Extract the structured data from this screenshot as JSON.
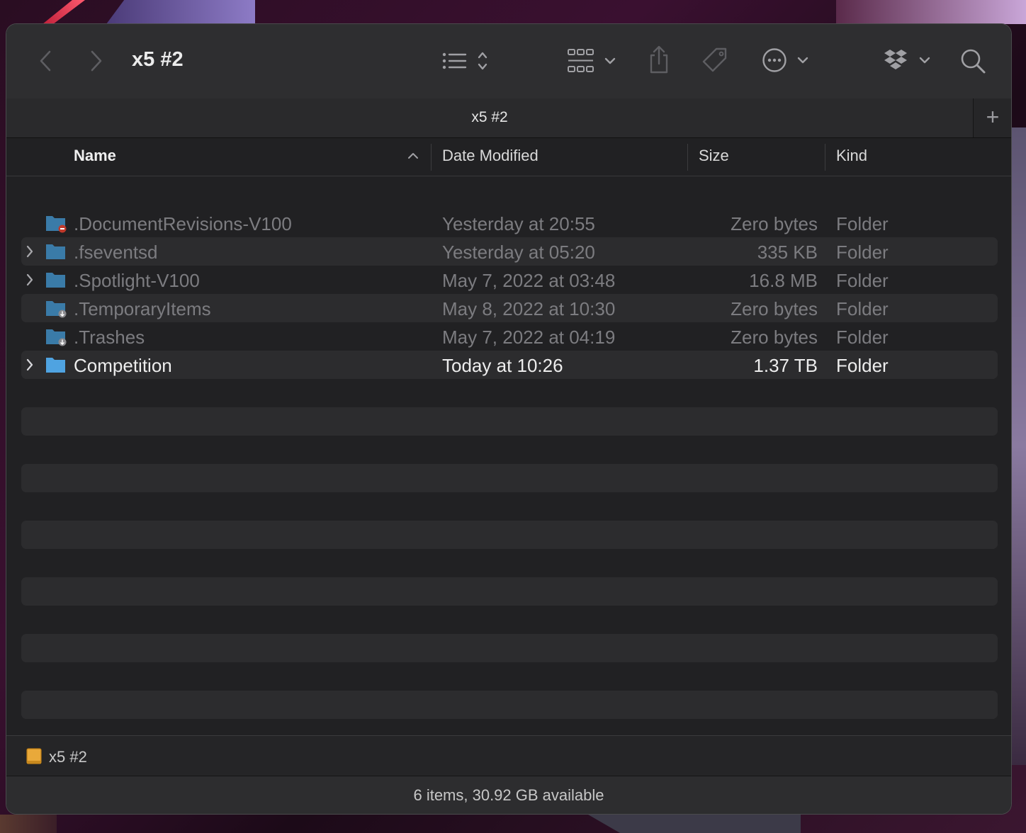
{
  "window": {
    "title": "x5 #2"
  },
  "toolbar": {
    "back": "chevron-left-icon",
    "forward": "chevron-right-icon",
    "view_list": "list-view-icon",
    "group": "grid-group-icon",
    "share": "share-icon",
    "tag": "tag-icon",
    "more": "ellipsis-circle-icon",
    "dropbox": "dropbox-icon",
    "search": "search-icon"
  },
  "tab": {
    "title": "x5 #2",
    "add": "+"
  },
  "columns": {
    "name": "Name",
    "date": "Date Modified",
    "size": "Size",
    "kind": "Kind"
  },
  "rows": [
    {
      "name": ".DocumentRevisions-V100",
      "date": "Yesterday at 20:55",
      "size": "Zero bytes",
      "kind": "Folder",
      "hidden": true,
      "expandable": false,
      "badge": "no-entry"
    },
    {
      "name": ".fseventsd",
      "date": "Yesterday at 05:20",
      "size": "335 KB",
      "kind": "Folder",
      "hidden": true,
      "expandable": true,
      "badge": ""
    },
    {
      "name": ".Spotlight-V100",
      "date": "May 7, 2022 at 03:48",
      "size": "16.8 MB",
      "kind": "Folder",
      "hidden": true,
      "expandable": true,
      "badge": ""
    },
    {
      "name": ".TemporaryItems",
      "date": "May 8, 2022 at 10:30",
      "size": "Zero bytes",
      "kind": "Folder",
      "hidden": true,
      "expandable": false,
      "badge": "download"
    },
    {
      "name": ".Trashes",
      "date": "May 7, 2022 at 04:19",
      "size": "Zero bytes",
      "kind": "Folder",
      "hidden": true,
      "expandable": false,
      "badge": "download"
    },
    {
      "name": "Competition",
      "date": "Today at 10:26",
      "size": "1.37 TB",
      "kind": "Folder",
      "hidden": false,
      "expandable": true,
      "badge": ""
    }
  ],
  "pathbar": {
    "label": "x5 #2"
  },
  "status": {
    "text": "6 items, 30.92 GB available"
  },
  "colors": {
    "folder": "#4fa3e0",
    "folder_dim": "#3b7ba8",
    "background": "#212123",
    "stripe": "#2c2c2e"
  }
}
